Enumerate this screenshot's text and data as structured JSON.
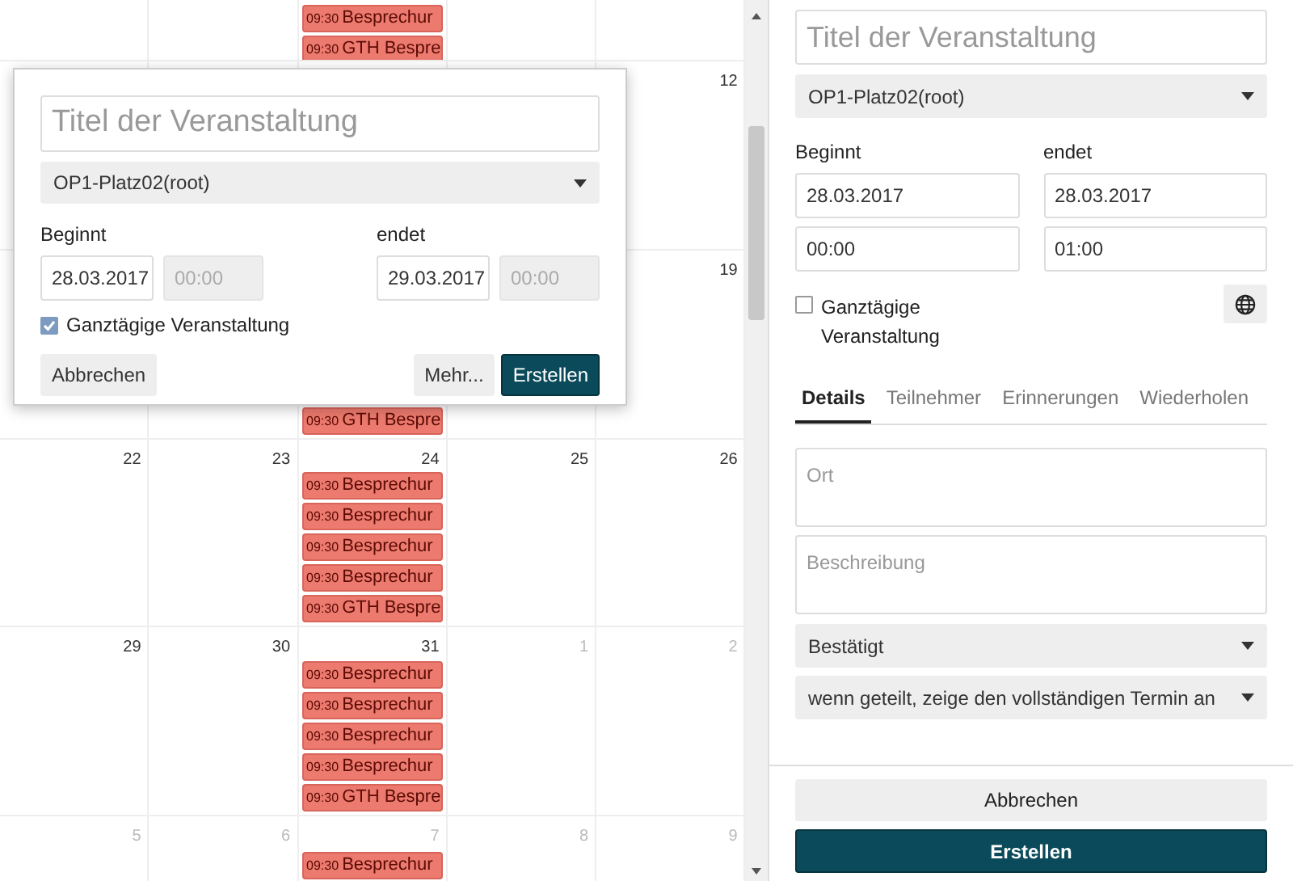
{
  "calendar": {
    "weeks": [
      {
        "events": [
          {
            "time": "09:30",
            "title": "Besprechur"
          },
          {
            "time": "09:30",
            "title": "GTH Bespre"
          }
        ]
      },
      {
        "day_numbers": [
          {
            "number": "12",
            "muted": false
          }
        ]
      },
      {
        "day_numbers": [
          {
            "number": "19",
            "muted": false
          }
        ],
        "events": [
          {
            "time": "09:30",
            "title": "GTH Bespre"
          }
        ]
      },
      {
        "day_numbers": [
          {
            "number": "22",
            "muted": false
          },
          {
            "number": "23",
            "muted": false
          },
          {
            "number": "24",
            "muted": false
          },
          {
            "number": "25",
            "muted": false
          },
          {
            "number": "26",
            "muted": false
          }
        ],
        "events": [
          {
            "time": "09:30",
            "title": "Besprechur"
          },
          {
            "time": "09:30",
            "title": "Besprechur"
          },
          {
            "time": "09:30",
            "title": "Besprechur"
          },
          {
            "time": "09:30",
            "title": "Besprechur"
          },
          {
            "time": "09:30",
            "title": "GTH Bespre"
          }
        ]
      },
      {
        "day_numbers": [
          {
            "number": "29",
            "muted": false
          },
          {
            "number": "30",
            "muted": false
          },
          {
            "number": "31",
            "muted": false
          },
          {
            "number": "1",
            "muted": true
          },
          {
            "number": "2",
            "muted": true
          }
        ],
        "events": [
          {
            "time": "09:30",
            "title": "Besprechur"
          },
          {
            "time": "09:30",
            "title": "Besprechur"
          },
          {
            "time": "09:30",
            "title": "Besprechur"
          },
          {
            "time": "09:30",
            "title": "Besprechur"
          },
          {
            "time": "09:30",
            "title": "GTH Bespre"
          }
        ]
      },
      {
        "day_numbers": [
          {
            "number": "5",
            "muted": true
          },
          {
            "number": "6",
            "muted": true
          },
          {
            "number": "7",
            "muted": true
          },
          {
            "number": "8",
            "muted": true
          },
          {
            "number": "9",
            "muted": true
          }
        ],
        "events": [
          {
            "time": "09:30",
            "title": "Besprechur"
          }
        ]
      }
    ]
  },
  "popup": {
    "title_placeholder": "Titel der Veranstaltung",
    "calendar": "OP1-Platz02(root)",
    "start": {
      "label": "Beginnt",
      "date": "28.03.2017",
      "time": "00:00",
      "time_disabled": true
    },
    "end": {
      "label": "endet",
      "date": "29.03.2017",
      "time": "00:00",
      "time_disabled": true
    },
    "all_day": {
      "label": "Ganztägige Veranstaltung",
      "checked": true
    },
    "buttons": {
      "cancel": "Abbrechen",
      "more": "Mehr...",
      "create": "Erstellen"
    }
  },
  "sidebar": {
    "title_placeholder": "Titel der Veranstaltung",
    "calendar": "OP1-Platz02(root)",
    "start": {
      "label": "Beginnt",
      "date": "28.03.2017",
      "time": "00:00",
      "time_disabled": false
    },
    "end": {
      "label": "endet",
      "date": "28.03.2017",
      "time": "01:00",
      "time_disabled": false
    },
    "all_day": {
      "label": "Ganztägige Veranstaltung",
      "checked": false
    },
    "tabs": [
      {
        "label": "Details",
        "selected": true
      },
      {
        "label": "Teilnehmer",
        "selected": false
      },
      {
        "label": "Erinnerungen",
        "selected": false
      },
      {
        "label": "Wiederholen",
        "selected": false
      }
    ],
    "location_placeholder": "Ort",
    "description_placeholder": "Beschreibung",
    "status": "Bestätigt",
    "visibility": "wenn geteilt, zeige den vollständigen Termin an",
    "buttons": {
      "cancel": "Abbrechen",
      "create": "Erstellen"
    }
  }
}
